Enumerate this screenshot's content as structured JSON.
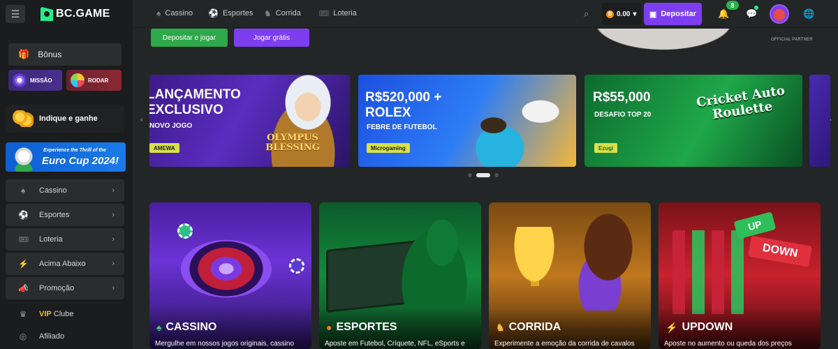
{
  "brand": {
    "name": "BC.GAME"
  },
  "sidebar": {
    "bonus_label": "Bônus",
    "mission_label": "MISSÃO",
    "spin_label": "RODAR",
    "refer_label": "Indique e ganhe",
    "euro_banner": {
      "line1": "Experience the Thrill of the",
      "line2": "Euro Cup 2024!"
    },
    "items": [
      {
        "label": "Cassino",
        "icon": "casino-icon"
      },
      {
        "label": "Esportes",
        "icon": "sports-icon"
      },
      {
        "label": "Loteria",
        "icon": "lottery-icon"
      },
      {
        "label": "Acima Abaixo",
        "icon": "updown-icon"
      },
      {
        "label": "Promoção",
        "icon": "promotion-icon"
      }
    ],
    "vip_prefix": "VIP",
    "vip_label": "Clube",
    "affiliate_label": "Afiliado"
  },
  "topbar": {
    "nav": [
      {
        "label": "Cassino",
        "icon": "casino-icon"
      },
      {
        "label": "Esportes",
        "icon": "sports-icon"
      },
      {
        "label": "Corrida",
        "icon": "racing-icon"
      },
      {
        "label": "Loteria",
        "icon": "lottery-icon"
      }
    ],
    "balance": "0.00",
    "deposit_label": "Depositar",
    "notification_count": "8"
  },
  "hero": {
    "deposit_play_label": "Depositar e jogar",
    "play_free_label": "Jogar grátis",
    "partner_label": "OFFICIAL PARTNER"
  },
  "banners": [
    {
      "title_line1": "LANÇAMENTO",
      "title_line2": "EXCLUSIVO",
      "subtitle": "NOVO JOGO",
      "game": "OLYMPUS BLESSING",
      "provider": "AMEWA"
    },
    {
      "title_line1": "R$520,000 +",
      "title_line2": "ROLEX",
      "subtitle": "FEBRE DE FUTEBOL",
      "provider": "Microgaming"
    },
    {
      "title_line1": "R$55,000",
      "subtitle": "DESAFIO TOP 20",
      "game": "Cricket Auto Roulette",
      "provider": "Ezugi"
    }
  ],
  "categories": [
    {
      "title": "CASSINO",
      "desc": "Mergulhe em nossos jogos originais, cassino",
      "icon": "spade-icon"
    },
    {
      "title": "ESPORTES",
      "desc": "Aposte em Futebol, Críquete, NFL, eSports e",
      "icon": "basketball-icon"
    },
    {
      "title": "CORRIDA",
      "desc": "Experimente a emoção da corrida de cavalos",
      "icon": "horse-icon"
    },
    {
      "title": "UPDOWN",
      "desc": "Aposte no aumento ou queda dos preços",
      "icon": "bolt-icon"
    }
  ],
  "updown_art": {
    "up": "UP",
    "down": "DOWN"
  },
  "colors": {
    "accent_green": "#24ee89",
    "deposit_purple": "#7d3ef0",
    "background": "#232626",
    "sidebar": "#1a1c1d"
  }
}
